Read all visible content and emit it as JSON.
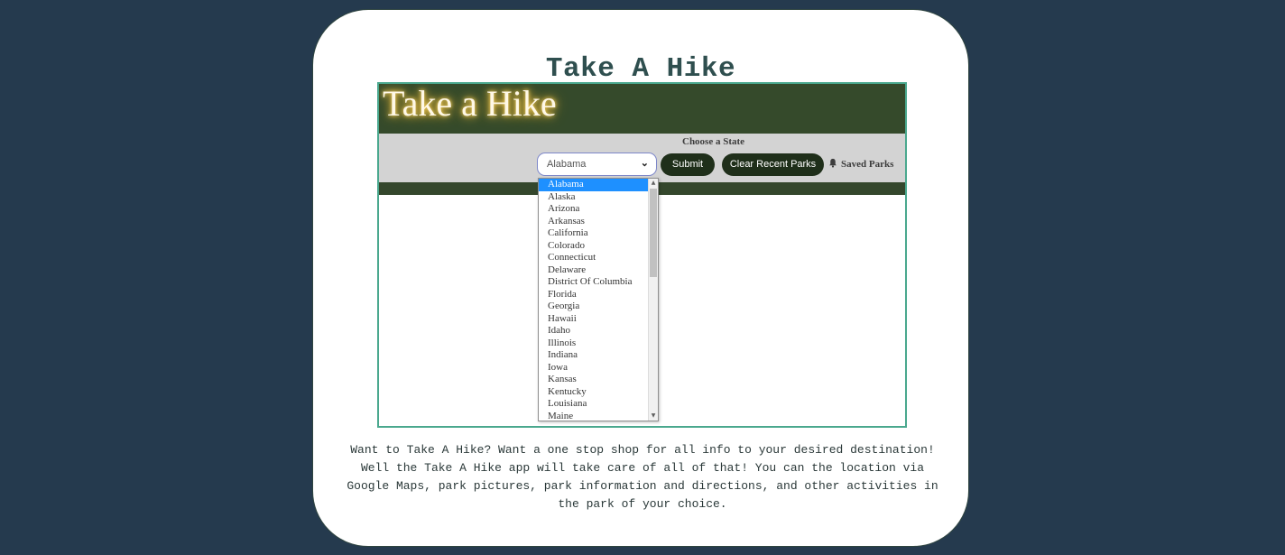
{
  "page": {
    "title": "Take A Hike",
    "description": "Want to Take A Hike? Want a one stop shop for all info to your desired destination! Well the Take A Hike app will take care of all of that! You can the location via Google Maps, park pictures, park information and directions, and other activities in the park of your choice."
  },
  "screenshot": {
    "app_title": "Take a Hike",
    "choose_label": "Choose a State",
    "select": {
      "value": "Alabama",
      "options": [
        "Alabama",
        "Alaska",
        "Arizona",
        "Arkansas",
        "California",
        "Colorado",
        "Connecticut",
        "Delaware",
        "District Of Columbia",
        "Florida",
        "Georgia",
        "Hawaii",
        "Idaho",
        "Illinois",
        "Indiana",
        "Iowa",
        "Kansas",
        "Kentucky",
        "Louisiana",
        "Maine"
      ]
    },
    "submit_label": "Submit",
    "clear_label": "Clear Recent Parks",
    "saved_label": "Saved Parks"
  },
  "colors": {
    "background": "#253a4e",
    "card": "#ffffff",
    "title": "#2f4f4f",
    "app_header": "#354a2b",
    "controls_bar": "#d3d3d3",
    "button": "#1f2f1a",
    "selected_option": "#1e90ff",
    "screenshot_border": "#4aa88e"
  },
  "icons": {
    "select_chevron": "chevron-down-icon",
    "saved_parks": "bell-icon",
    "scroll_up": "scroll-up-arrow-icon",
    "scroll_down": "scroll-down-arrow-icon"
  }
}
